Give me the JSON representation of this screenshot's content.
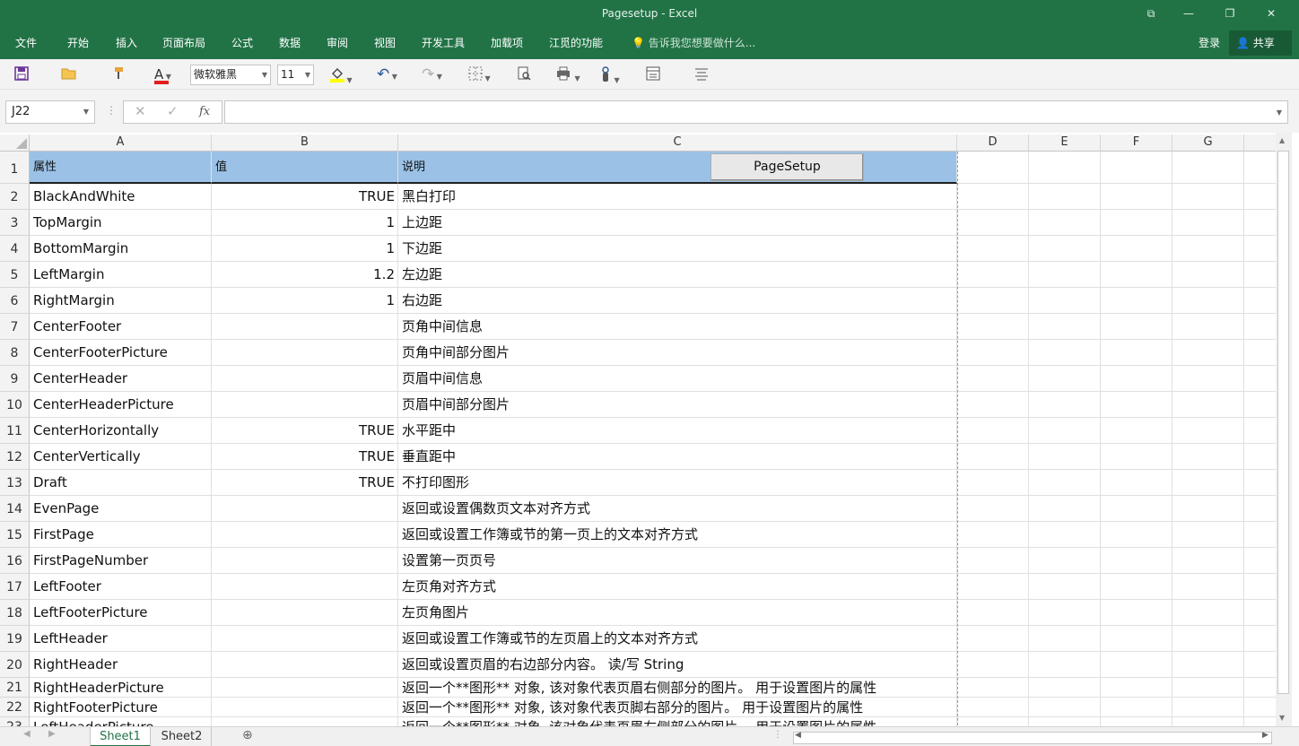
{
  "window": {
    "title": "Pagesetup - Excel",
    "controls": [
      "⧉",
      "—",
      "❐",
      "✕"
    ]
  },
  "ribbon": {
    "tabs": [
      "文件",
      "开始",
      "插入",
      "页面布局",
      "公式",
      "数据",
      "审阅",
      "视图",
      "开发工具",
      "加载项",
      "江觅的功能"
    ],
    "tell_me": "告诉我您想要做什么...",
    "login": "登录",
    "share": "共享"
  },
  "toolbar": {
    "font_name": "微软雅黑",
    "font_size": "11",
    "icons": [
      "save-icon",
      "open-folder-icon",
      "format-painter-icon",
      "font-color-icon",
      "fill-color-icon",
      "undo-icon",
      "redo-icon",
      "borders-icon",
      "print-preview-icon",
      "print-icon",
      "touch-mode-icon",
      "form-icon",
      "align-icon"
    ],
    "font_color": "#e02020",
    "fill_color": "#ffff00"
  },
  "formula_bar": {
    "name_box": "J22",
    "fx": "fx",
    "value": ""
  },
  "sheet": {
    "columns": [
      "A",
      "B",
      "C",
      "D",
      "E",
      "F",
      "G"
    ],
    "header_row": {
      "row": "1",
      "a": "属性",
      "b": "值",
      "c": "说明"
    },
    "button_label": "PageSetup",
    "rows": [
      {
        "row": "2",
        "a": "BlackAndWhite",
        "b": "TRUE",
        "c": "黑白打印"
      },
      {
        "row": "3",
        "a": "TopMargin",
        "b": "1",
        "c": "上边距"
      },
      {
        "row": "4",
        "a": "BottomMargin",
        "b": "1",
        "c": "下边距"
      },
      {
        "row": "5",
        "a": "LeftMargin",
        "b": "1.2",
        "c": "左边距"
      },
      {
        "row": "6",
        "a": "RightMargin",
        "b": "1",
        "c": "右边距"
      },
      {
        "row": "7",
        "a": "CenterFooter",
        "b": "",
        "c": "页角中间信息"
      },
      {
        "row": "8",
        "a": "CenterFooterPicture",
        "b": "",
        "c": "页角中间部分图片"
      },
      {
        "row": "9",
        "a": "CenterHeader",
        "b": "",
        "c": "页眉中间信息"
      },
      {
        "row": "10",
        "a": "CenterHeaderPicture",
        "b": "",
        "c": "页眉中间部分图片"
      },
      {
        "row": "11",
        "a": "CenterHorizontally",
        "b": "TRUE",
        "c": "水平距中"
      },
      {
        "row": "12",
        "a": "CenterVertically",
        "b": "TRUE",
        "c": "垂直距中"
      },
      {
        "row": "13",
        "a": "Draft",
        "b": "TRUE",
        "c": "不打印图形"
      },
      {
        "row": "14",
        "a": "EvenPage",
        "b": "",
        "c": "返回或设置偶数页文本对齐方式"
      },
      {
        "row": "15",
        "a": "FirstPage",
        "b": "",
        "c": "返回或设置工作簿或节的第一页上的文本对齐方式"
      },
      {
        "row": "16",
        "a": "FirstPageNumber",
        "b": "",
        "c": "设置第一页页号"
      },
      {
        "row": "17",
        "a": "LeftFooter",
        "b": "",
        "c": "左页角对齐方式"
      },
      {
        "row": "18",
        "a": "LeftFooterPicture",
        "b": "",
        "c": "左页角图片"
      },
      {
        "row": "19",
        "a": "LeftHeader",
        "b": "",
        "c": "返回或设置工作簿或节的左页眉上的文本对齐方式"
      },
      {
        "row": "20",
        "a": "RightHeader",
        "b": "",
        "c": "返回或设置页眉的右边部分内容。 读/写 String"
      },
      {
        "row": "21",
        "a": "RightHeaderPicture",
        "b": "",
        "c": "返回一个**图形** 对象, 该对象代表页眉右侧部分的图片。 用于设置图片的属性"
      },
      {
        "row": "22",
        "a": "RightFooterPicture",
        "b": "",
        "c": "返回一个**图形** 对象, 该对象代表页脚右部分的图片。 用于设置图片的属性"
      },
      {
        "row": "23",
        "a": "LeftHeaderPicture",
        "b": "",
        "c": "返回一个**图形** 对象, 该对象代表页眉左侧部分的图片。 用于设置图片的属性"
      }
    ]
  },
  "sheet_tabs": [
    "Sheet1",
    "Sheet2"
  ],
  "active_sheet": "Sheet1",
  "colors": {
    "ribbon": "#217346",
    "header_fill": "#9bc2e6"
  }
}
